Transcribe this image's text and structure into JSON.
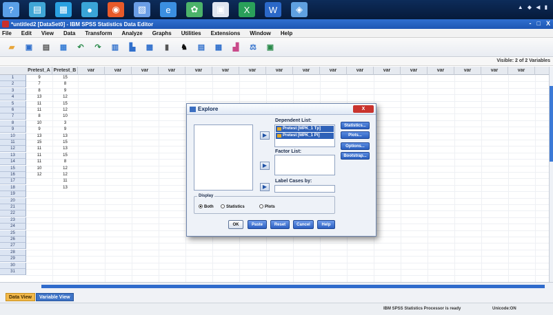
{
  "taskbar": {
    "icons": [
      "spss-icon",
      "explorer-icon",
      "app-icon",
      "chrome-icon",
      "firefox-icon",
      "paint-icon",
      "edge-icon",
      "photo-icon",
      "media-icon",
      "excel-icon",
      "word-icon",
      "remote-icon"
    ],
    "icon_colors": [
      "#5aa0e8",
      "#3fa6d6",
      "#2aa0e0",
      "#3aa5d8",
      "#e85a2a",
      "#6a9de6",
      "#3b8fe0",
      "#4cb36a",
      "#e0e6f0",
      "#2aa05a",
      "#2b68c8",
      "#5fa0e0"
    ]
  },
  "window": {
    "title": "*untitled2 [DataSet0] - IBM SPSS Statistics Data Editor",
    "controls": [
      "-",
      "□",
      "X"
    ]
  },
  "menu": [
    "File",
    "Edit",
    "View",
    "Data",
    "Transform",
    "Analyze",
    "Graphs",
    "Utilities",
    "Extensions",
    "Window",
    "Help"
  ],
  "toolbar": {
    "icon_names": [
      "open-icon",
      "save-icon",
      "print-icon",
      "recall-dialog-icon",
      "undo-icon",
      "redo-icon",
      "goto-case-icon",
      "goto-variable-icon",
      "variables-icon",
      "run-descriptives-icon",
      "find-icon",
      "insert-cases-icon",
      "insert-variable-icon",
      "split-file-icon",
      "weight-cases-icon",
      "select-cases-icon"
    ],
    "icon_colors": [
      "#e8a63a",
      "#2f6fcc",
      "#555",
      "#3a7fd6",
      "#2a8a4a",
      "#2a8a4a",
      "#2f6fcc",
      "#2f6fcc",
      "#2f6fcc",
      "#555",
      "#111",
      "#2f6fcc",
      "#2f6fcc",
      "#c94a8a",
      "#2f6fcc",
      "#2a8a4a"
    ]
  },
  "status_right": "Visible: 2 of 2 Variables",
  "grid": {
    "columns": [
      "Pretest_A",
      "Pretest_B",
      "var",
      "var",
      "var",
      "var",
      "var",
      "var",
      "var",
      "var",
      "var",
      "var",
      "var",
      "var",
      "var",
      "var",
      "var",
      "var",
      "var"
    ],
    "row_numbers": [
      "1",
      "2",
      "3",
      "4",
      "5",
      "6",
      "7",
      "8",
      "9",
      "10",
      "11",
      "12",
      "13",
      "14",
      "15",
      "16",
      "17",
      "18",
      "19",
      "20",
      "21",
      "22",
      "23",
      "24",
      "25",
      "26",
      "27",
      "28",
      "29",
      "30",
      "31"
    ],
    "values_a": [
      "9",
      "7",
      "8",
      "13",
      "11",
      "11",
      "8",
      "10",
      "9",
      "13",
      "15",
      "11",
      "11",
      "11",
      "10",
      "12",
      "",
      "",
      "",
      "",
      "",
      "",
      "",
      "",
      "",
      "",
      "",
      "",
      "",
      "",
      ""
    ],
    "values_b": [
      "15",
      "8",
      "9",
      "12",
      "15",
      "12",
      "10",
      "3",
      "9",
      "13",
      "15",
      "13",
      "15",
      "8",
      "12",
      "12",
      "11",
      "13",
      "",
      "",
      "",
      "",
      "",
      "",
      "",
      "",
      "",
      "",
      "",
      "",
      ""
    ]
  },
  "tabs": {
    "data_view": "Data View",
    "variable_view": "Variable View"
  },
  "statusbar": {
    "main": "IBM SPSS Statistics Processor is ready",
    "unicode": "Unicode:ON"
  },
  "dialog": {
    "title": "Explore",
    "close": "X",
    "dependent_label": "Dependent List:",
    "dependent_items": [
      "Pretest [MPK_1 Tp]",
      "Pretest [MPK_1 Pt]"
    ],
    "factor_label": "Factor List:",
    "label_cases": "Label Cases by:",
    "side_buttons": [
      "Statistics...",
      "Plots...",
      "Options...",
      "Bootstrap..."
    ],
    "display_label": "Display",
    "display_options": [
      "Both",
      "Statistics",
      "Plots"
    ],
    "bottom_buttons": [
      "OK",
      "Paste",
      "Reset",
      "Cancel",
      "Help"
    ]
  }
}
